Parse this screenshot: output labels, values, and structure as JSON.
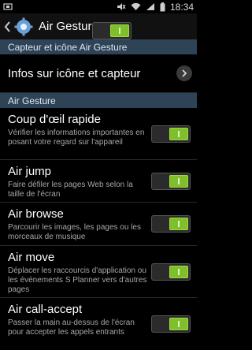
{
  "status_bar": {
    "time": "18:34",
    "icons": [
      "usb-debug-icon",
      "mute-icon",
      "wifi-icon",
      "signal-icon",
      "battery-icon"
    ]
  },
  "action_bar": {
    "title": "Air Gesture",
    "master_toggle_on": true
  },
  "sections": {
    "sensor_header": "Capteur et icône Air Gesture",
    "air_gesture_header": "Air Gesture"
  },
  "info_row": {
    "title": "Infos sur icône et capteur"
  },
  "settings": [
    {
      "title": "Coup d'œil rapide",
      "desc": "Vérifier les informations importantes en posant votre regard sur l'appareil",
      "on": true
    },
    {
      "title": "Air jump",
      "desc": "Faire défiler les pages Web selon la taille de l'écran",
      "on": true
    },
    {
      "title": "Air browse",
      "desc": "Parcourir les images, les pages ou les morceaux de musique",
      "on": true
    },
    {
      "title": "Air move",
      "desc": "Déplacer les raccourcis d'application ou les événements S Planner vers d'autres pages",
      "on": true
    },
    {
      "title": "Air call-accept",
      "desc": "Passer la main au-dessus de l'écran pour accepter les appels entrants",
      "on": true
    }
  ],
  "colors": {
    "section_bg": "#2e4356",
    "toggle_on": "#7fbf2a"
  }
}
